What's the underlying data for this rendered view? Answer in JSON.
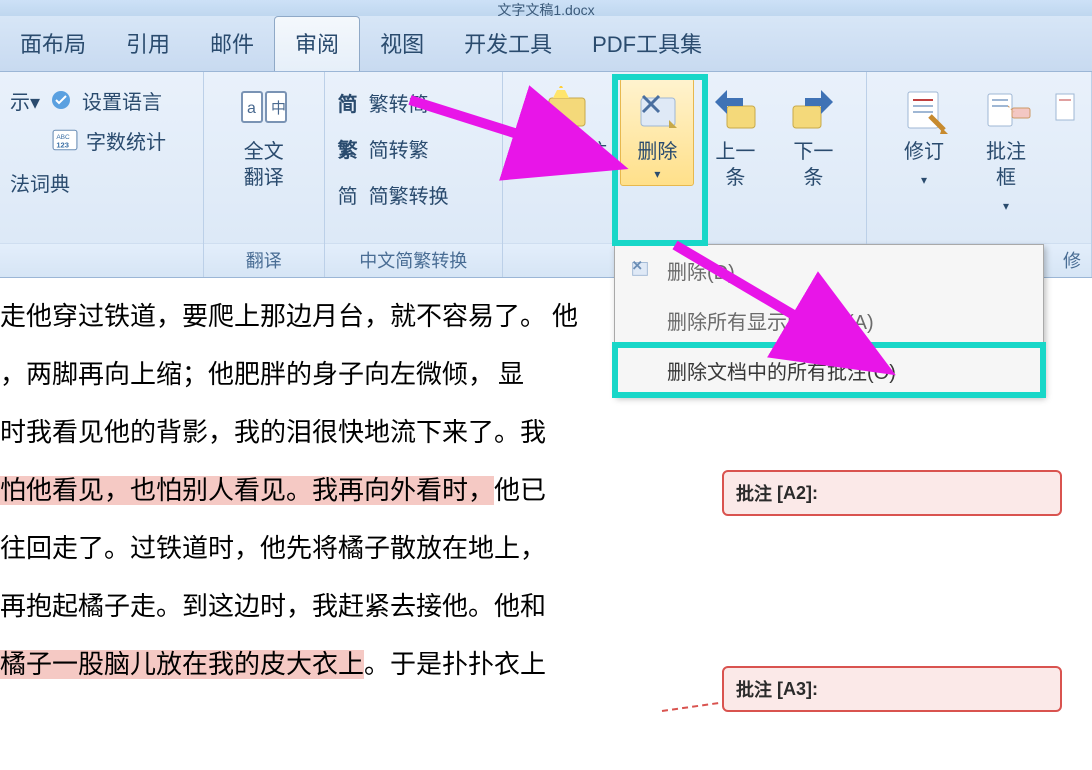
{
  "window": {
    "title": "文字文稿1.docx"
  },
  "tabs": {
    "layout": "面布局",
    "reference": "引用",
    "mail": "邮件",
    "review": "审阅",
    "view": "视图",
    "dev": "开发工具",
    "pdf": "PDF工具集"
  },
  "ribbon": {
    "proofing": {
      "markup_label": "示▾",
      "set_language": "设置语言",
      "word_count": "字数统计",
      "thesaurus": "法词典"
    },
    "translate": {
      "btn": "全文\n翻译",
      "group": "翻译"
    },
    "scc": {
      "s2t": "繁转简",
      "t2s": "简转繁",
      "convert": "简繁转换",
      "group": "中文简繁转换"
    },
    "comments": {
      "new": "新建批注",
      "delete": "删除",
      "prev": "上一\n条",
      "next": "下一\n条"
    },
    "tracking": {
      "track": "修订",
      "balloon": "批注框",
      "more": "修"
    },
    "delete_menu": {
      "item1": "删除(D)",
      "item2": "删除所有显示的批注(A)",
      "item3": "删除文档中的所有批注(O)"
    }
  },
  "document": {
    "l1a": "走他穿过铁道，要爬上那边月台，就不容易了。",
    "l1b": "他",
    "l2a": "两脚再向上缩；他肥胖的身子向左微倾，",
    "l2b": "显",
    "l2pre": "，",
    "l3": "时我看见他的背影，我的泪很快地流下来了。我",
    "l4a": "怕他看见，也怕别人看见。我再向外看时，",
    "l4b": "他已",
    "l5": "往回走了。过铁道时，他先将橘子散放在地上，",
    "l6": "再抱起橘子走。到这边时，我赶紧去接他。他和",
    "l7a": "橘子一股脑儿放在我的皮大衣上",
    "l7b": "。于是扑扑衣上"
  },
  "comments": {
    "label": "批注",
    "c1": "[A2]:",
    "c2": "[A3]:"
  }
}
